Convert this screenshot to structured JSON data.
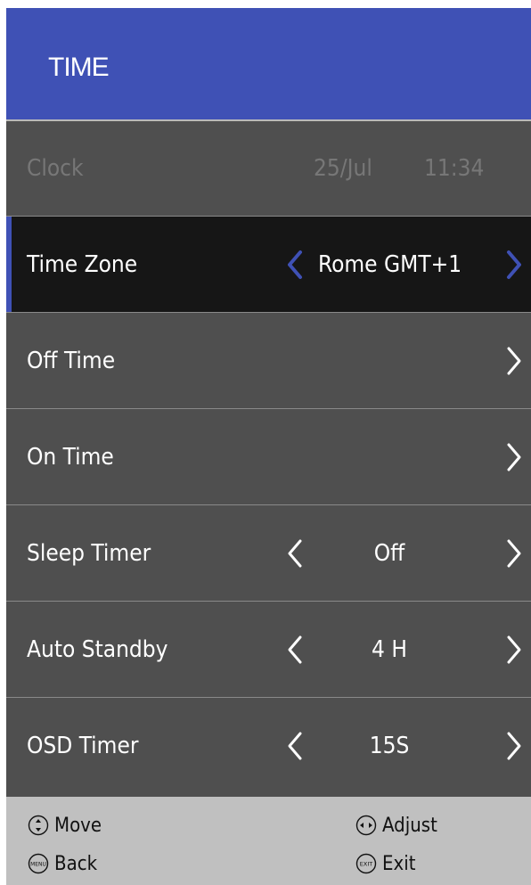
{
  "header": {
    "title": "TIME"
  },
  "rows": {
    "clock": {
      "label": "Clock",
      "date": "25/Jul",
      "time": "11:34"
    },
    "time_zone": {
      "label": "Time Zone",
      "value": "Rome GMT+1"
    },
    "off_time": {
      "label": "Off Time"
    },
    "on_time": {
      "label": "On Time"
    },
    "sleep_timer": {
      "label": "Sleep Timer",
      "value": "Off"
    },
    "auto_standby": {
      "label": "Auto Standby",
      "value": "4 H"
    },
    "osd_timer": {
      "label": "OSD Timer",
      "value": "15S"
    }
  },
  "footer": {
    "move": "Move",
    "adjust": "Adjust",
    "back": "Back",
    "exit": "Exit",
    "menu_icon_text": "MENU",
    "exit_icon_text": "EXIT"
  },
  "colors": {
    "accent": "#3f51b5",
    "row_bg": "#4f4f4f",
    "selected_bg": "#161616",
    "footer_bg": "#c0c0c0"
  }
}
